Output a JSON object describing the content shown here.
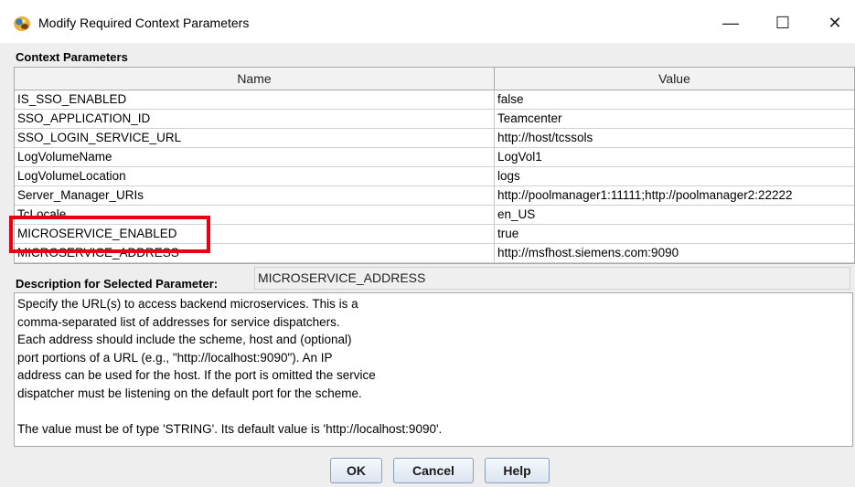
{
  "window": {
    "title": "Modify Required Context Parameters",
    "controls": {
      "minimize": "—",
      "maximize": "☐",
      "close": "✕"
    }
  },
  "context_parameters": {
    "section_label": "Context Parameters",
    "columns": [
      "Name",
      "Value"
    ],
    "rows": [
      {
        "name": "IS_SSO_ENABLED",
        "value": "false"
      },
      {
        "name": "SSO_APPLICATION_ID",
        "value": "Teamcenter"
      },
      {
        "name": "SSO_LOGIN_SERVICE_URL",
        "value": "http://host/tcssols"
      },
      {
        "name": "LogVolumeName",
        "value": "LogVol1"
      },
      {
        "name": "LogVolumeLocation",
        "value": "logs"
      },
      {
        "name": "Server_Manager_URIs",
        "value": "http://poolmanager1:11111;http://poolmanager2:22222"
      },
      {
        "name": "TcLocale",
        "value": "en_US"
      },
      {
        "name": "MICROSERVICE_ENABLED",
        "value": "true"
      },
      {
        "name": "MICROSERVICE_ADDRESS",
        "value": "http://msfhost.siemens.com:9090"
      }
    ],
    "highlight_color": "#e60012"
  },
  "description": {
    "label": "Description for Selected Parameter:",
    "selected_parameter": "MICROSERVICE_ADDRESS",
    "lines": [
      "Specify the URL(s) to access backend microservices.  This is a",
      "comma-separated list of addresses for service dispatchers.",
      "Each address should include the scheme, host and (optional)",
      "port portions of a URL (e.g., \"http://localhost:9090\").  An IP",
      "address can be used for the host.  If the port is omitted the service",
      "dispatcher must be listening on the default port for the scheme.",
      "",
      "The value must be of type 'STRING'.  Its default value is 'http://localhost:9090'."
    ]
  },
  "buttons": {
    "ok": "OK",
    "cancel": "Cancel",
    "help": "Help"
  }
}
